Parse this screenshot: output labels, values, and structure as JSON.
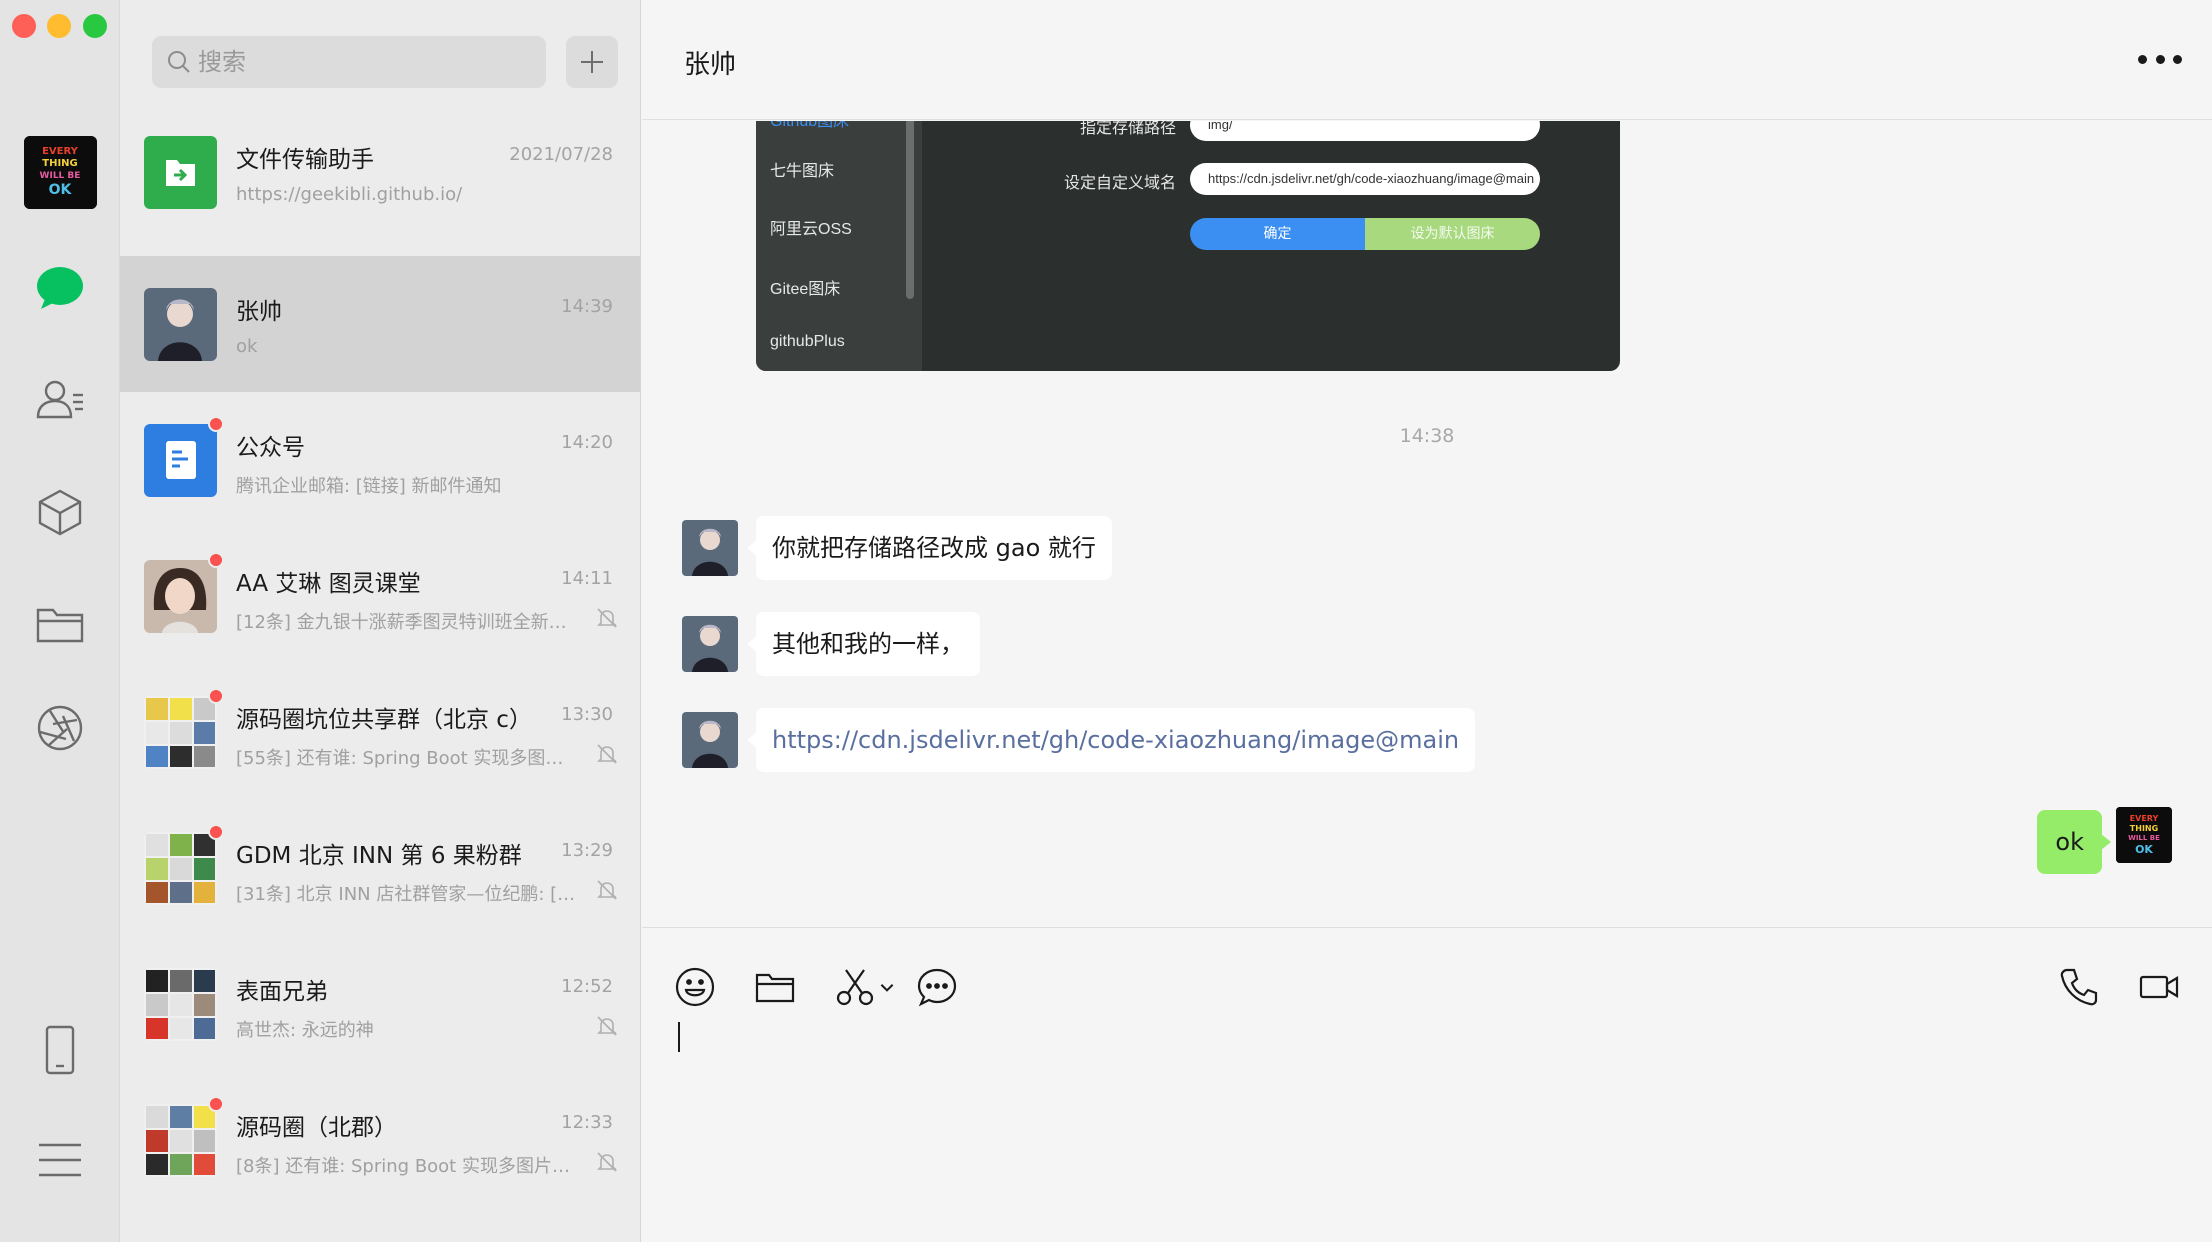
{
  "search": {
    "placeholder": "搜索"
  },
  "conversations": [
    {
      "title": "文件传输助手",
      "time": "2021/07/28",
      "preview": "https://geekibli.github.io/",
      "unread": false,
      "muted": false,
      "avatar": "file-transfer"
    },
    {
      "title": "张帅",
      "time": "14:39",
      "preview": "ok",
      "unread": false,
      "muted": false,
      "avatar": "person",
      "active": true
    },
    {
      "title": "公众号",
      "time": "14:20",
      "preview": "腾讯企业邮箱: [链接] 新邮件通知",
      "unread": true,
      "muted": false,
      "avatar": "official-account"
    },
    {
      "title": "AA 艾琳  图灵课堂",
      "time": "14:11",
      "preview": "[12条] 金九银十涨薪季图灵特训班全新…",
      "unread": true,
      "muted": true,
      "avatar": "person-photo"
    },
    {
      "title": "源码圈坑位共享群（北京 c）",
      "time": "13:30",
      "preview": "[55条] 还有谁: Spring Boot 实现多图片…",
      "unread": true,
      "muted": true,
      "avatar": "group-grid"
    },
    {
      "title": "GDM 北京 INN 第 6 果粉群",
      "time": "13:29",
      "preview": "[31条] 北京 INN 店社群管家—位纪鹏: […",
      "unread": true,
      "muted": true,
      "avatar": "group-grid"
    },
    {
      "title": "表面兄弟",
      "time": "12:52",
      "preview": "高世杰: 永远的神",
      "unread": false,
      "muted": true,
      "avatar": "group-grid"
    },
    {
      "title": "源码圈（北郡）",
      "time": "12:33",
      "preview": "[8条] 还有谁: Spring Boot 实现多图片…",
      "unread": true,
      "muted": true,
      "avatar": "group-grid"
    }
  ],
  "chat": {
    "title": "张帅",
    "screenshot": {
      "side_items": [
        "Github图床",
        "七牛图床",
        "阿里云OSS",
        "Gitee图床",
        "githubPlus"
      ],
      "labels": {
        "path": "指定存储路径",
        "domain": "设定自定义域名"
      },
      "path_value": "img/",
      "domain_value": "https://cdn.jsdelivr.net/gh/code-xiaozhuang/image@main",
      "confirm": "确定",
      "set_default": "设为默认图床"
    },
    "time_separator": "14:38",
    "messages": [
      {
        "from": "other",
        "text": "你就把存储路径改成 gao 就行"
      },
      {
        "from": "other",
        "text": "其他和我的一样，"
      },
      {
        "from": "other",
        "text": "https://cdn.jsdelivr.net/gh/code-xiaozhuang/image@main",
        "link": true
      },
      {
        "from": "me",
        "text": "ok"
      }
    ]
  },
  "icons": {
    "nav": [
      "chat-icon",
      "contacts-icon",
      "favorites-icon",
      "files-icon",
      "moments-icon",
      "phone-icon",
      "menu-icon"
    ],
    "toolbar": [
      "emoji-icon",
      "folder-icon",
      "scissors-icon",
      "chat-bubble-icon",
      "phone-call-icon",
      "video-call-icon"
    ]
  },
  "colors": {
    "accent": "#07c160",
    "my_bubble": "#95ec69",
    "unread_dot": "#fa5151",
    "link": "#5a6fa0"
  }
}
